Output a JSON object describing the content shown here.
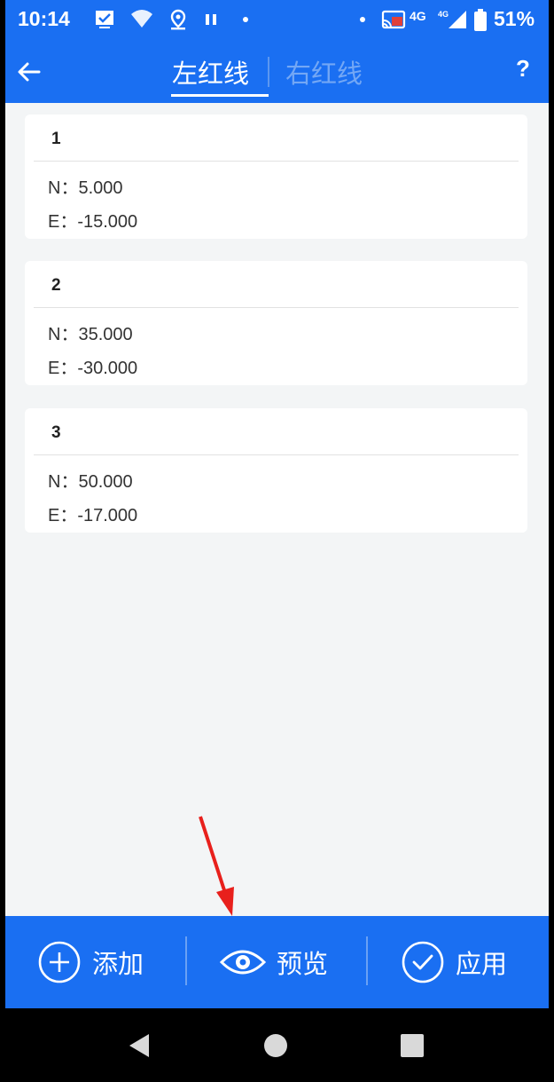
{
  "status_bar": {
    "time": "10:14",
    "network": "4G",
    "battery": "51%"
  },
  "header": {
    "tabs": [
      {
        "label": "左红线",
        "active": true
      },
      {
        "label": "右红线",
        "active": false
      }
    ],
    "help": "?"
  },
  "points": [
    {
      "index": "1",
      "n_label": "N：",
      "n_value": "5.000",
      "e_label": "E：",
      "e_value": "-15.000"
    },
    {
      "index": "2",
      "n_label": "N：",
      "n_value": "35.000",
      "e_label": "E：",
      "e_value": "-30.000"
    },
    {
      "index": "3",
      "n_label": "N：",
      "n_value": "50.000",
      "e_label": "E：",
      "e_value": "-17.000"
    }
  ],
  "actions": {
    "add": "添加",
    "preview": "预览",
    "apply": "应用"
  },
  "colors": {
    "primary": "#1a6ff2",
    "background": "#f3f5f6",
    "annotation_arrow": "#e8201c"
  }
}
